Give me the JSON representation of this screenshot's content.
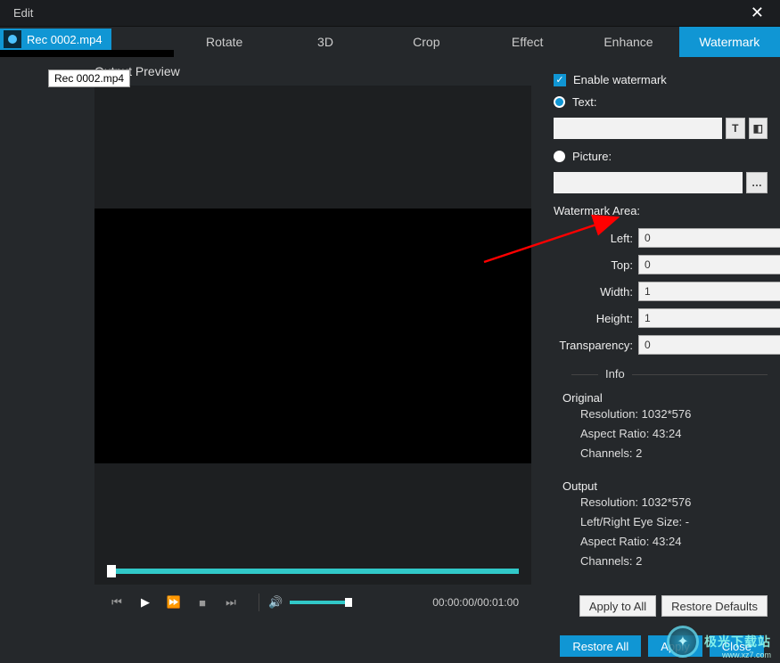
{
  "titlebar": {
    "title": "Edit"
  },
  "filetab": {
    "name": "Rec 0002.mp4"
  },
  "tooltip": "Rec 0002.mp4",
  "tabs": {
    "rotate": "Rotate",
    "threeD": "3D",
    "crop": "Crop",
    "effect": "Effect",
    "enhance": "Enhance",
    "watermark": "Watermark"
  },
  "preview": {
    "label": "Output Preview",
    "time": "00:00:00/00:01:00"
  },
  "watermark": {
    "enable_label": "Enable watermark",
    "text_label": "Text:",
    "text_value": "",
    "picture_label": "Picture:",
    "picture_value": "",
    "area_label": "Watermark Area:",
    "fields": {
      "left_label": "Left:",
      "left_value": "0",
      "top_label": "Top:",
      "top_value": "0",
      "width_label": "Width:",
      "width_value": "1",
      "height_label": "Height:",
      "height_value": "1",
      "transparency_label": "Transparency:",
      "transparency_value": "0"
    }
  },
  "info": {
    "header": "Info",
    "original_label": "Original",
    "original": {
      "resolution": "Resolution: 1032*576",
      "aspect": "Aspect Ratio: 43:24",
      "channels": "Channels: 2"
    },
    "output_label": "Output",
    "output": {
      "resolution": "Resolution: 1032*576",
      "eye": "Left/Right Eye Size: -",
      "aspect": "Aspect Ratio: 43:24",
      "channels": "Channels: 2"
    }
  },
  "buttons": {
    "apply_all": "Apply to All",
    "restore_defaults": "Restore Defaults",
    "restore_all": "Restore All",
    "apply": "Apply",
    "close": "Close"
  },
  "badge": {
    "text": "极光下载站",
    "sub": "www.xz7.com"
  }
}
